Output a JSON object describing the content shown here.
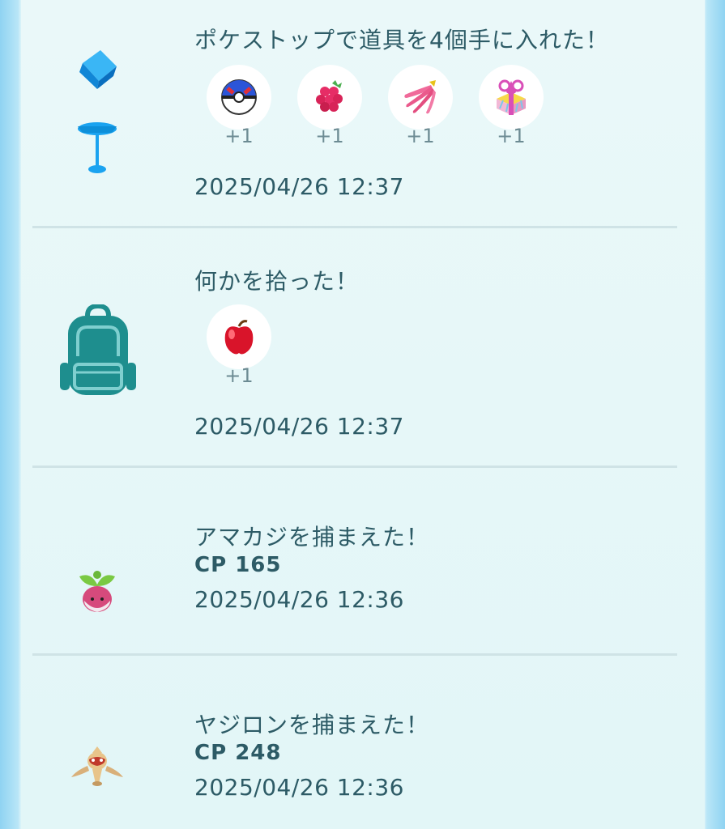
{
  "entries": [
    {
      "title": "ポケストップで道具を4個手に入れた！",
      "icon": "pokestop-icon",
      "items": [
        {
          "icon": "great-ball-icon",
          "count": "+1"
        },
        {
          "icon": "razz-berry-icon",
          "count": "+1"
        },
        {
          "icon": "nanab-berry-icon",
          "count": "+1"
        },
        {
          "icon": "gift-icon",
          "count": "+1"
        }
      ],
      "date": "2025/04/26 12:37"
    },
    {
      "title": "何かを拾った！",
      "icon": "backpack-icon",
      "items": [
        {
          "icon": "apple-icon",
          "count": "+1"
        }
      ],
      "date": "2025/04/26 12:37"
    },
    {
      "title": "アマカジを捕まえた！",
      "icon": "bounsweet-icon",
      "cp": "CP 165",
      "date": "2025/04/26 12:36"
    },
    {
      "title": "ヤジロンを捕まえた！",
      "icon": "baltoy-icon",
      "cp": "CP 248",
      "date": "2025/04/26 12:36"
    }
  ],
  "colors": {
    "text": "#2d5b66",
    "count": "#6c8b93",
    "divider": "#cfe3e6",
    "pokestop": "#1aa3f0",
    "backpack": "#1e8e8e"
  }
}
